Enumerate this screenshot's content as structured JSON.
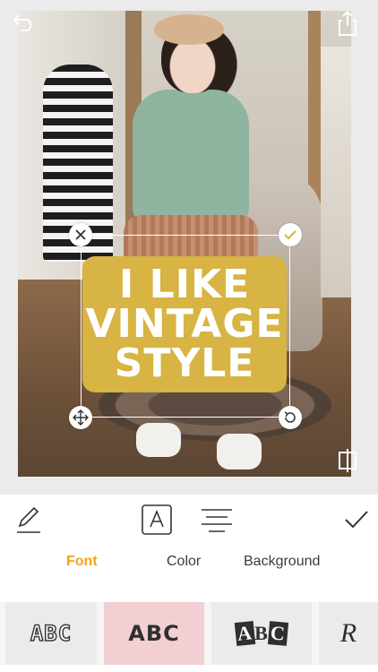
{
  "sticker": {
    "line1": "I LIKE",
    "line2": "VINTAGE",
    "line3": "STYLE",
    "bg_color": "#d7b443"
  },
  "toolbar_tabs": {
    "font": "Font",
    "color": "Color",
    "background": "Background",
    "active": "Font",
    "active_color": "#f3a31c"
  },
  "font_samples": [
    {
      "label": "ABC"
    },
    {
      "label": "ABC"
    },
    {
      "label": "ABC"
    },
    {
      "label": "R"
    }
  ],
  "icons": {
    "undo": "undo-arrow-icon",
    "share": "share-icon",
    "compare": "compare-icon",
    "close": "close-icon",
    "confirm": "check-icon",
    "move": "move-arrows-icon",
    "rotate": "rotate-icon",
    "edit": "pencil-icon",
    "font_style": "font-a-icon",
    "align": "align-lines-icon",
    "done": "check-icon"
  }
}
